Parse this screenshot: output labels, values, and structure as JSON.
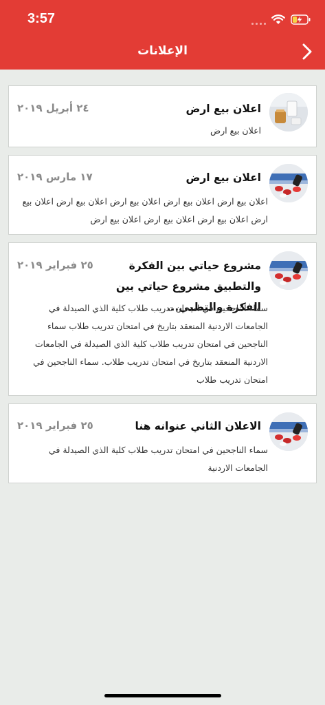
{
  "status_bar": {
    "time": "3:57"
  },
  "header": {
    "title": "الإعلانات",
    "back_icon": "chevron-right-icon"
  },
  "colors": {
    "header_bg": "#e33c35",
    "page_bg": "#e9ece9",
    "date_text": "#8a8a8a"
  },
  "announcements": [
    {
      "title": "اعلان بيع ارض",
      "date": "٢٤ أبريل ٢٠١٩",
      "body": "اعلان بيع ارض",
      "thumbnail": "milk-jug-thumbnail"
    },
    {
      "title": "اعلان بيع ارض",
      "date": "١٧ مارس ٢٠١٩",
      "body": "اعلان بيع ارض اعلان بيع ارض اعلان بيع ارض اعلان بيع ارض اعلان بيع ارض اعلان بيع ارض اعلان بيع ارض اعلان بيع ارض",
      "thumbnail": "pills-thumbnail"
    },
    {
      "title": "مشروع حياتي بين الفكرة والتطبيق مشروع حياتي بين الفكرة والتطبي...",
      "date": "٢٥ فبراير ٢٠١٩",
      "body": "سماء الناجحين في امتحان تدريب طلاب كلية الذي الصيدلة في الجامعات الاردنية المنعقد بتاريخ في امتحان تدريب طلاب سماء الناجحين في امتحان تدريب طلاب كلية الذي الصيدلة في الجامعات الاردنية المنعقد بتاريخ في امتحان تدريب طلاب. سماء الناجحين في امتحان تدريب طلاب",
      "thumbnail": "pills-thumbnail"
    },
    {
      "title": "الاعلان الثاني عنوانه هنا",
      "date": "٢٥ فبراير ٢٠١٩",
      "body": "سماء الناجحين في امتحان تدريب طلاب كلية الذي الصيدلة في الجامعات الاردنية",
      "thumbnail": "pills-thumbnail"
    }
  ]
}
